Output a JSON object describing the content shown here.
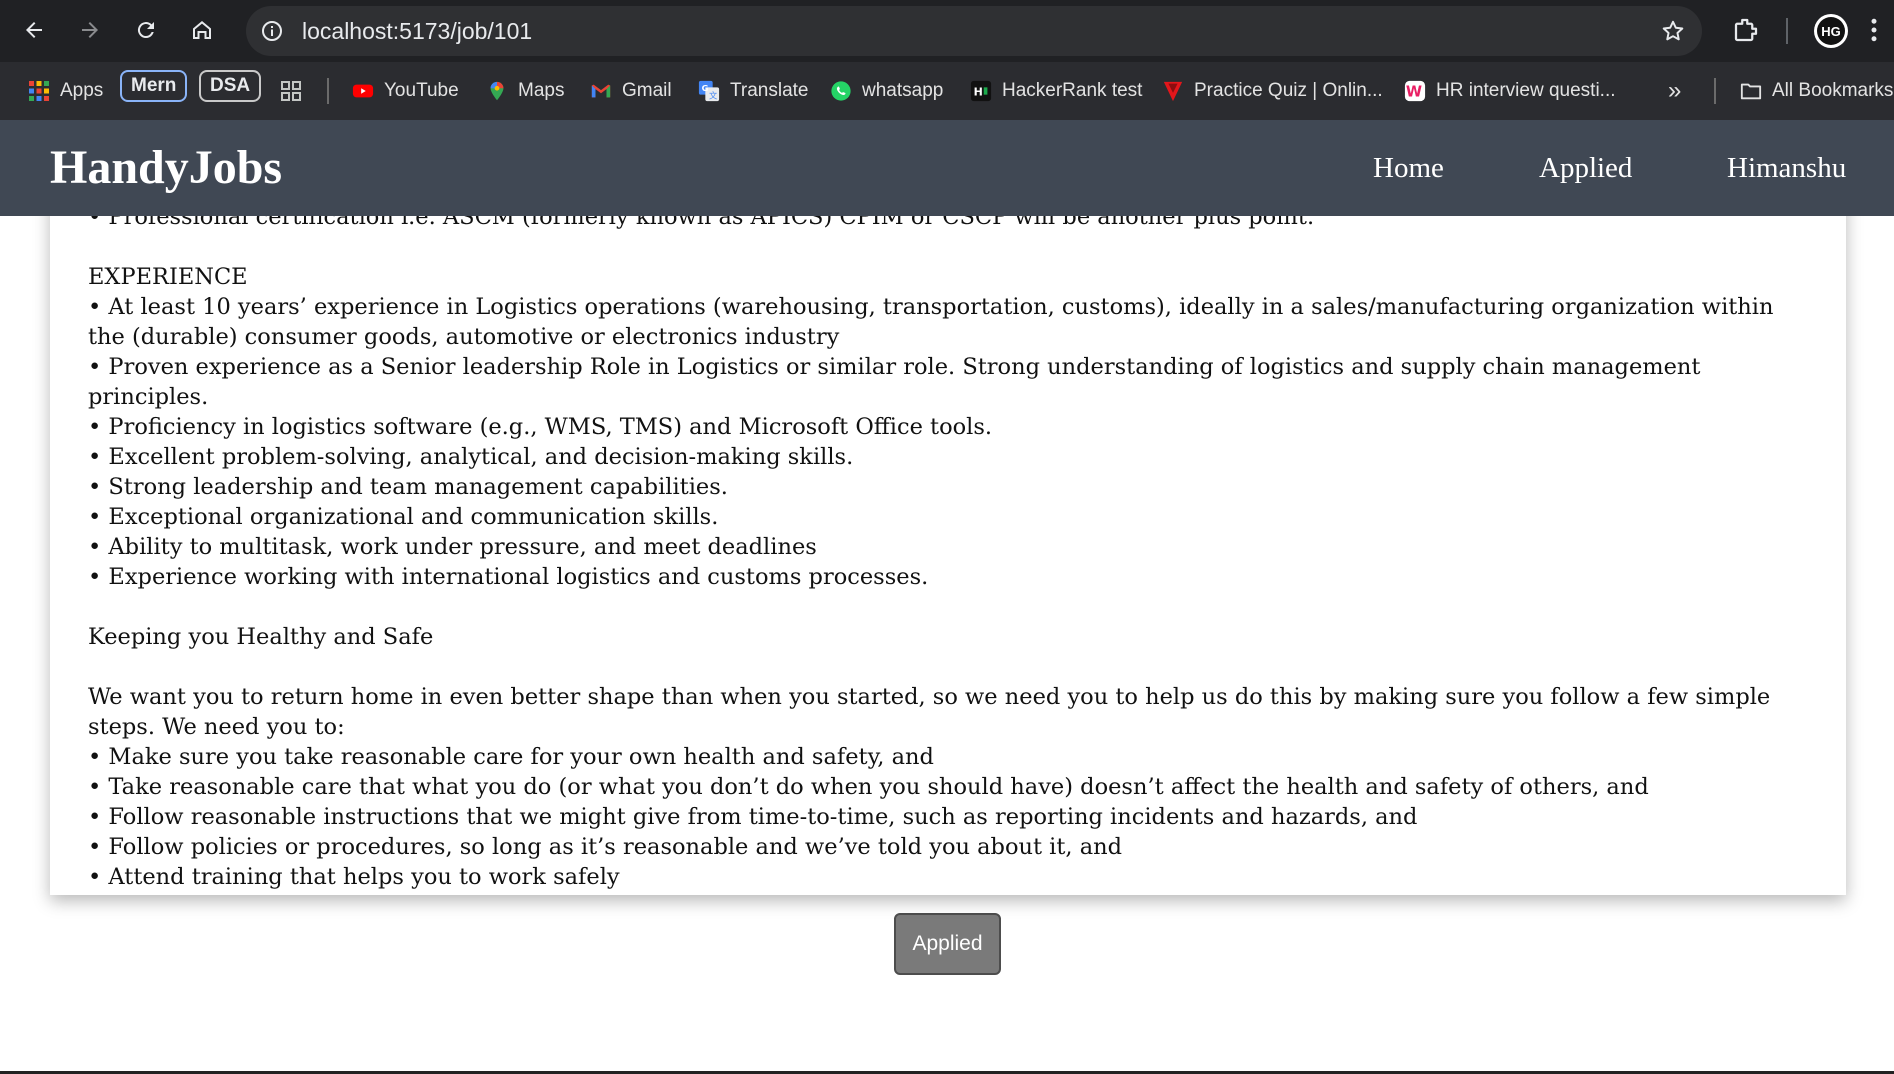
{
  "browser": {
    "url": "localhost:5173/job/101",
    "bookmarks": {
      "apps": "Apps",
      "mern": "Mern",
      "dsa": "DSA",
      "youtube": "YouTube",
      "maps": "Maps",
      "gmail": "Gmail",
      "translate": "Translate",
      "whatsapp": "whatsapp",
      "hackerrank": "HackerRank test",
      "practice_quiz": "Practice Quiz | Onlin...",
      "hr_interview": "HR interview questi...",
      "overflow": "»",
      "all_bookmarks": "All Bookmarks"
    }
  },
  "navbar": {
    "brand": "HandyJobs",
    "links": {
      "home": "Home",
      "applied": "Applied",
      "user": "Himanshu"
    }
  },
  "job": {
    "partial_line": "• Professional certification i.e. ASCM (formerly known as APICS) CPIM or CSCP will be another plus point.",
    "experience_heading": "EXPERIENCE",
    "experience_items": [
      "• At least 10 years’ experience in Logistics operations (warehousing, transportation, customs), ideally in a sales/manufacturing organization within the (durable) consumer goods, automotive or electronics industry",
      "• Proven experience as a Senior leadership Role in Logistics or similar role. Strong understanding of logistics and supply chain management principles.",
      "• Proficiency in logistics software (e.g., WMS, TMS) and Microsoft Office tools.",
      "• Excellent problem-solving, analytical, and decision-making skills.",
      "• Strong leadership and team management capabilities.",
      "• Exceptional organizational and communication skills.",
      "• Ability to multitask, work under pressure, and meet deadlines",
      "• Experience working with international logistics and customs processes."
    ],
    "safety_heading": "Keeping you Healthy and Safe",
    "safety_intro": "We want you to return home in even better shape than when you started, so we need you to help us do this by making sure you follow a few simple steps. We need you to:",
    "safety_items": [
      "• Make sure you take reasonable care for your own health and safety, and",
      "• Take reasonable care that what you do (or what you don’t do when you should have) doesn’t affect the health and safety of others, and",
      "• Follow reasonable instructions that we might give from time-to-time, such as reporting incidents and hazards, and",
      "• Follow policies or procedures, so long as it’s reasonable and we’ve told you about it, and",
      "• Attend training that helps you to work safely"
    ]
  },
  "actions": {
    "applied_label": "Applied"
  }
}
